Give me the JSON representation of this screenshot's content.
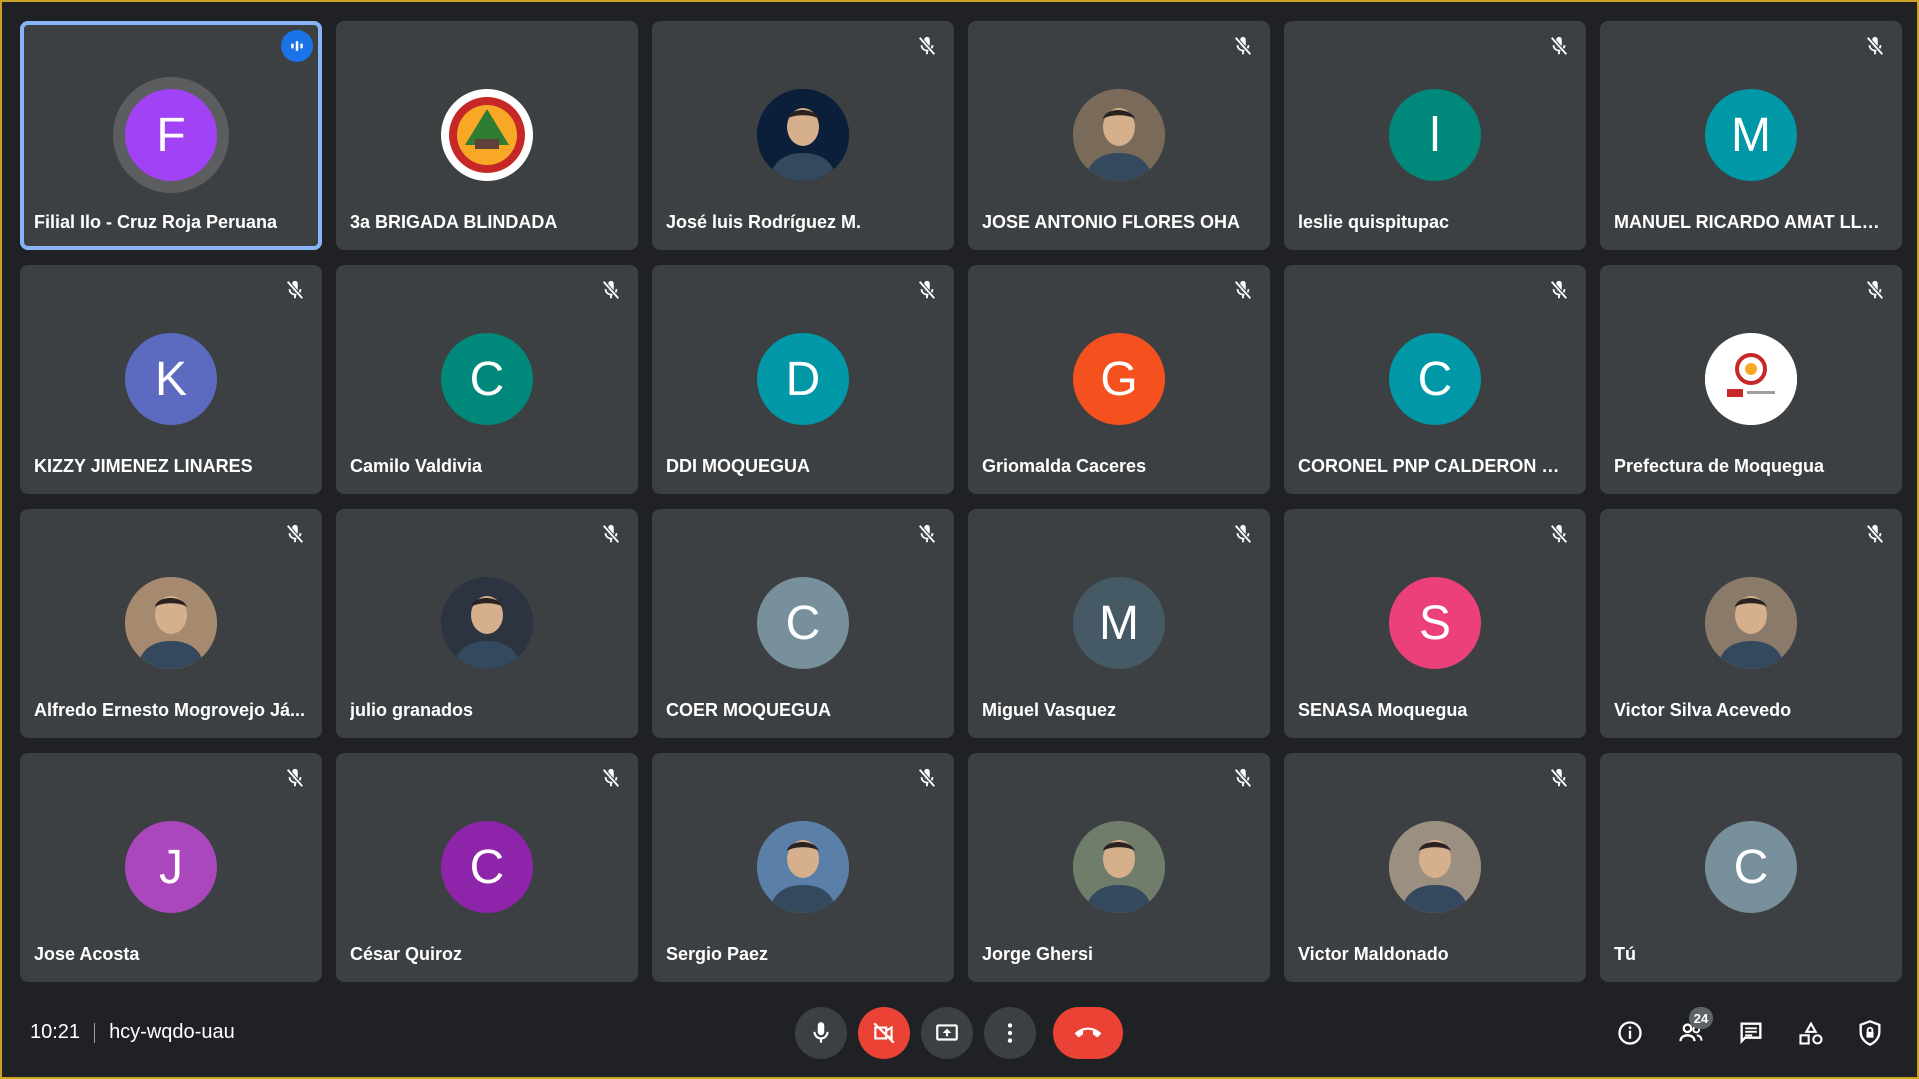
{
  "participants": [
    {
      "name": "Filial Ilo - Cruz Roja Peruana",
      "initial": "F",
      "color": "#a142f4",
      "type": "letter",
      "muted": false,
      "speaking": true
    },
    {
      "name": "3a BRIGADA BLINDADA",
      "initial": "",
      "color": "#2e7d32",
      "type": "emblem",
      "muted": false,
      "speaking": false
    },
    {
      "name": "José luis Rodríguez M.",
      "initial": "",
      "color": "#0b1e3a",
      "type": "photo",
      "muted": true,
      "speaking": false
    },
    {
      "name": "JOSE ANTONIO FLORES OHA",
      "initial": "",
      "color": "#7a6a5a",
      "type": "photo",
      "muted": true,
      "speaking": false
    },
    {
      "name": "leslie quispitupac",
      "initial": "l",
      "color": "#00897b",
      "type": "letter",
      "muted": true,
      "speaking": false
    },
    {
      "name": "MANUEL RICARDO AMAT LLER...",
      "initial": "M",
      "color": "#0097a7",
      "type": "letter",
      "muted": true,
      "speaking": false
    },
    {
      "name": "KIZZY JIMENEZ LINARES",
      "initial": "K",
      "color": "#5c6bc0",
      "type": "letter",
      "muted": true,
      "speaking": false
    },
    {
      "name": "Camilo Valdivia",
      "initial": "C",
      "color": "#00897b",
      "type": "letter",
      "muted": true,
      "speaking": false
    },
    {
      "name": "DDI MOQUEGUA",
      "initial": "D",
      "color": "#0097a7",
      "type": "letter",
      "muted": true,
      "speaking": false
    },
    {
      "name": "Griomalda Caceres",
      "initial": "G",
      "color": "#f4511e",
      "type": "letter",
      "muted": true,
      "speaking": false
    },
    {
      "name": "CORONEL PNP CALDERON CO...",
      "initial": "C",
      "color": "#0097a7",
      "type": "letter",
      "muted": true,
      "speaking": false
    },
    {
      "name": "Prefectura de Moquegua",
      "initial": "",
      "color": "#ffffff",
      "type": "logo",
      "muted": true,
      "speaking": false
    },
    {
      "name": "Alfredo Ernesto Mogrovejo Já...",
      "initial": "",
      "color": "#a58a70",
      "type": "photo",
      "muted": true,
      "speaking": false
    },
    {
      "name": "julio granados",
      "initial": "",
      "color": "#2b3440",
      "type": "photo",
      "muted": true,
      "speaking": false
    },
    {
      "name": "COER MOQUEGUA",
      "initial": "C",
      "color": "#78909c",
      "type": "letter",
      "muted": true,
      "speaking": false
    },
    {
      "name": "Miguel Vasquez",
      "initial": "M",
      "color": "#455a64",
      "type": "letter",
      "muted": true,
      "speaking": false
    },
    {
      "name": "SENASA Moquegua",
      "initial": "S",
      "color": "#ec407a",
      "type": "letter",
      "muted": true,
      "speaking": false
    },
    {
      "name": "Victor Silva Acevedo",
      "initial": "",
      "color": "#8a7a6a",
      "type": "photo",
      "muted": true,
      "speaking": false
    },
    {
      "name": "Jose Acosta",
      "initial": "J",
      "color": "#ab47bc",
      "type": "letter",
      "muted": true,
      "speaking": false
    },
    {
      "name": "César Quiroz",
      "initial": "C",
      "color": "#8e24aa",
      "type": "letter",
      "muted": true,
      "speaking": false
    },
    {
      "name": "Sergio Paez",
      "initial": "",
      "color": "#5a7fa8",
      "type": "photo",
      "muted": true,
      "speaking": false
    },
    {
      "name": "Jorge Ghersi",
      "initial": "",
      "color": "#6f7d6a",
      "type": "photo",
      "muted": true,
      "speaking": false
    },
    {
      "name": "Victor Maldonado",
      "initial": "",
      "color": "#9a8f80",
      "type": "photo",
      "muted": true,
      "speaking": false
    },
    {
      "name": "Tú",
      "initial": "C",
      "color": "#78909c",
      "type": "letter",
      "muted": false,
      "speaking": false
    }
  ],
  "meeting": {
    "time": "10:21",
    "code": "hcy-wqdo-uau"
  },
  "controls": {
    "participant_count": "24"
  },
  "icons": {
    "mic": "microphone-icon",
    "camera_off": "camera-off-icon",
    "present": "present-screen-icon",
    "more": "more-vert-icon",
    "end_call": "end-call-icon",
    "info": "info-icon",
    "people": "people-icon",
    "chat": "chat-icon",
    "activities": "activities-icon",
    "host_controls": "host-controls-icon"
  },
  "colors": {
    "background": "#202124",
    "tile": "#3c4043",
    "active_outline": "#8ab4f8",
    "danger": "#ea4335",
    "speaking_badge": "#1a73e8"
  }
}
